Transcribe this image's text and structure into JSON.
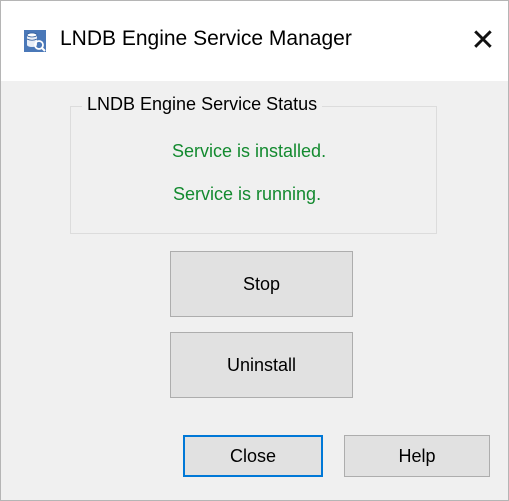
{
  "window": {
    "title": "LNDB Engine Service Manager",
    "close_glyph": "✕",
    "icon": "database-app-icon"
  },
  "status_group": {
    "label": "LNDB Engine Service Status",
    "installed_text": "Service is installed.",
    "running_text": "Service is running.",
    "status_color": "#138a2f"
  },
  "buttons": {
    "stop": "Stop",
    "uninstall": "Uninstall",
    "close": "Close",
    "help": "Help"
  },
  "colors": {
    "focus_border": "#0078d7",
    "button_face": "#e1e1e1",
    "dialog_bg": "#f0f0f0"
  }
}
